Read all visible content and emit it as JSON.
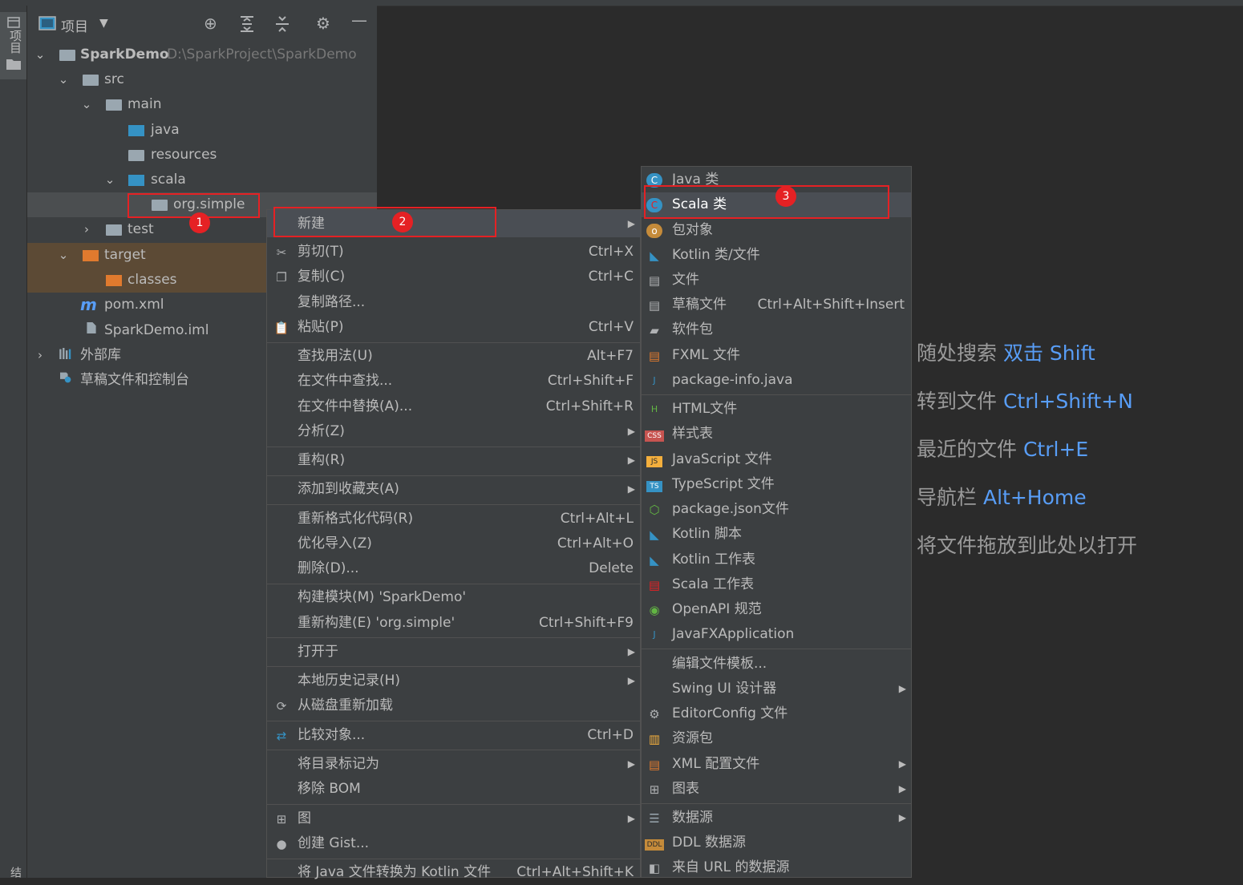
{
  "window": {
    "side_tab_label": "项目",
    "side_tab_bottom": "结"
  },
  "project_panel": {
    "title": "项目",
    "tree": [
      {
        "label": "SparkDemo",
        "path": "D:\\SparkProject\\SparkDemo"
      },
      {
        "label": "src"
      },
      {
        "label": "main"
      },
      {
        "label": "java"
      },
      {
        "label": "resources"
      },
      {
        "label": "scala"
      },
      {
        "label": "org.simple"
      },
      {
        "label": "test"
      },
      {
        "label": "target"
      },
      {
        "label": "classes"
      },
      {
        "label": "pom.xml"
      },
      {
        "label": "SparkDemo.iml"
      },
      {
        "label": "外部库"
      },
      {
        "label": "草稿文件和控制台"
      }
    ]
  },
  "badges": [
    "1",
    "2",
    "3"
  ],
  "context_menu": {
    "items": [
      {
        "label": "新建"
      },
      {
        "label": "剪切(T)",
        "shortcut": "Ctrl+X"
      },
      {
        "label": "复制(C)",
        "shortcut": "Ctrl+C"
      },
      {
        "label": "复制路径..."
      },
      {
        "label": "粘贴(P)",
        "shortcut": "Ctrl+V"
      },
      {
        "label": "查找用法(U)",
        "shortcut": "Alt+F7"
      },
      {
        "label": "在文件中查找...",
        "shortcut": "Ctrl+Shift+F"
      },
      {
        "label": "在文件中替换(A)...",
        "shortcut": "Ctrl+Shift+R"
      },
      {
        "label": "分析(Z)"
      },
      {
        "label": "重构(R)"
      },
      {
        "label": "添加到收藏夹(A)"
      },
      {
        "label": "重新格式化代码(R)",
        "shortcut": "Ctrl+Alt+L"
      },
      {
        "label": "优化导入(Z)",
        "shortcut": "Ctrl+Alt+O"
      },
      {
        "label": "删除(D)...",
        "shortcut": "Delete"
      },
      {
        "label": "构建模块(M) 'SparkDemo'"
      },
      {
        "label": "重新构建(E) 'org.simple'",
        "shortcut": "Ctrl+Shift+F9"
      },
      {
        "label": "打开于"
      },
      {
        "label": "本地历史记录(H)"
      },
      {
        "label": "从磁盘重新加载"
      },
      {
        "label": "比较对象...",
        "shortcut": "Ctrl+D"
      },
      {
        "label": "将目录标记为"
      },
      {
        "label": "移除 BOM"
      },
      {
        "label": "图"
      },
      {
        "label": "创建 Gist..."
      },
      {
        "label": "将 Java 文件转换为 Kotlin 文件",
        "shortcut": "Ctrl+Alt+Shift+K"
      }
    ]
  },
  "new_submenu": {
    "items": [
      {
        "label": "Java 类"
      },
      {
        "label": "Scala 类"
      },
      {
        "label": "包对象"
      },
      {
        "label": "Kotlin 类/文件"
      },
      {
        "label": "文件"
      },
      {
        "label": "草稿文件",
        "shortcut": "Ctrl+Alt+Shift+Insert"
      },
      {
        "label": "软件包"
      },
      {
        "label": "FXML 文件"
      },
      {
        "label": "package-info.java"
      },
      {
        "label": "HTML文件"
      },
      {
        "label": "样式表"
      },
      {
        "label": "JavaScript 文件"
      },
      {
        "label": "TypeScript 文件"
      },
      {
        "label": "package.json文件"
      },
      {
        "label": "Kotlin 脚本"
      },
      {
        "label": "Kotlin 工作表"
      },
      {
        "label": "Scala 工作表"
      },
      {
        "label": "OpenAPI 规范"
      },
      {
        "label": "JavaFXApplication"
      },
      {
        "label": "编辑文件模板..."
      },
      {
        "label": "Swing UI 设计器"
      },
      {
        "label": "EditorConfig 文件"
      },
      {
        "label": "资源包"
      },
      {
        "label": "XML 配置文件"
      },
      {
        "label": "图表"
      },
      {
        "label": "数据源"
      },
      {
        "label": "DDL 数据源"
      },
      {
        "label": "来自 URL 的数据源"
      }
    ],
    "icon_labels": {
      "css": "CSS",
      "js": "JS",
      "ts": "TS",
      "ddl": "DDL",
      "html": "H",
      "java": "J"
    }
  },
  "editor_hints": [
    {
      "text": "随处搜索",
      "key": "双击 Shift"
    },
    {
      "text": "转到文件",
      "key": "Ctrl+Shift+N"
    },
    {
      "text": "最近的文件",
      "key": "Ctrl+E"
    },
    {
      "text": "导航栏",
      "key": "Alt+Home"
    },
    {
      "text": "将文件拖放到此处以打开",
      "key": ""
    }
  ],
  "colors": {
    "accent": "#589df6",
    "selection": "#4b6eaf",
    "annotation": "#e52124"
  }
}
